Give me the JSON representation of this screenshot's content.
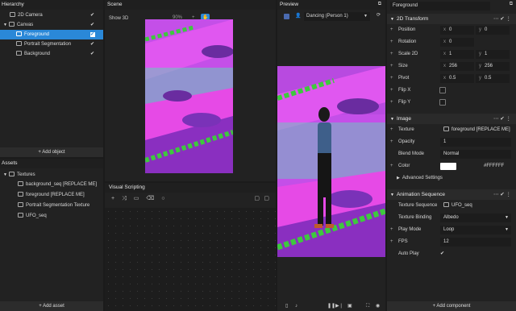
{
  "hierarchy": {
    "title": "Hierarchy",
    "items": [
      {
        "label": "2D Camera"
      },
      {
        "label": "Canvas"
      },
      {
        "label": "Foreground"
      },
      {
        "label": "Portrait Segmentation"
      },
      {
        "label": "Background"
      }
    ],
    "add_button": "+ Add object"
  },
  "assets": {
    "title": "Assets",
    "folder": "Textures",
    "items": [
      {
        "label": "background_seq [REPLACE ME]"
      },
      {
        "label": "foreground [REPLACE ME]"
      },
      {
        "label": "Portrait Segmentation Texture"
      },
      {
        "label": "UFO_seq"
      }
    ],
    "add_button": "+ Add asset"
  },
  "scene": {
    "title": "Scene",
    "show3d": "Show 3D",
    "zoom": "90%"
  },
  "visual_scripting": {
    "title": "Visual Scripting"
  },
  "preview": {
    "title": "Preview",
    "dropdown": "Dancing (Person 1)"
  },
  "inspector": {
    "object_name": "Foreground",
    "transform": {
      "title": "2D Transform",
      "position": {
        "label": "Position",
        "x": "0",
        "y": "0"
      },
      "rotation": {
        "label": "Rotation",
        "value": "0"
      },
      "scale": {
        "label": "Scale 2D",
        "x": "1",
        "y": "1"
      },
      "size": {
        "label": "Size",
        "x": "256",
        "y": "256"
      },
      "pivot": {
        "label": "Pivot",
        "x": "0.5",
        "y": "0.5"
      },
      "flipx": "Flip X",
      "flipy": "Flip Y"
    },
    "image": {
      "title": "Image",
      "texture_label": "Texture",
      "texture_value": "foreground [REPLACE ME]",
      "opacity_label": "Opacity",
      "opacity_value": "1",
      "blend_label": "Blend Mode",
      "blend_value": "Normal",
      "color_label": "Color",
      "color_value": "#FFFFFF",
      "advanced": "Advanced Settings"
    },
    "animation": {
      "title": "Animation Sequence",
      "texture_seq_label": "Texture Sequence",
      "texture_seq_value": "UFO_seq",
      "binding_label": "Texture Binding",
      "binding_value": "Albedo",
      "play_label": "Play Mode",
      "play_value": "Loop",
      "fps_label": "FPS",
      "fps_value": "12",
      "autoplay_label": "Auto Play"
    },
    "add_component": "+ Add component",
    "xy": {
      "x": "x",
      "y": "y"
    }
  },
  "colors": {
    "accent": "#2a88d8",
    "magenta": "#e64ae6",
    "purple": "#9a3fd0",
    "green": "#3ec83e"
  }
}
